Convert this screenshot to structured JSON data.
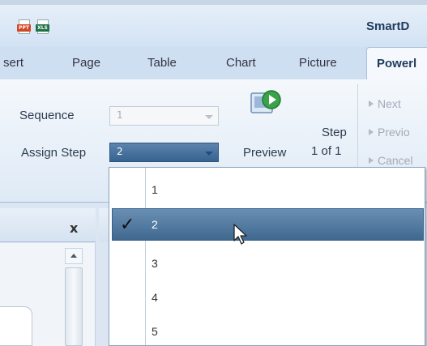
{
  "app": {
    "title": "SmartD"
  },
  "quick_access": {
    "icons": [
      "ppt-file-icon",
      "xls-file-icon"
    ],
    "ppt_label": "PPT",
    "xls_label": "XLS"
  },
  "tabs": [
    {
      "label": "sert",
      "active": false
    },
    {
      "label": "Page",
      "active": false
    },
    {
      "label": "Table",
      "active": false
    },
    {
      "label": "Chart",
      "active": false
    },
    {
      "label": "Picture",
      "active": false
    },
    {
      "label": "Powerl",
      "active": true
    }
  ],
  "ribbon": {
    "sequence": {
      "label": "Sequence",
      "value": "1"
    },
    "assign_step": {
      "label": "Assign Step",
      "value": "2"
    },
    "preview_label": "Preview",
    "step": {
      "label": "Step",
      "count": "1 of 1"
    },
    "nav": {
      "next": "Next",
      "previous": "Previo",
      "cancel": "Cancel"
    }
  },
  "panel": {
    "close_glyph": "x"
  },
  "dropdown": {
    "options": [
      "1",
      "2",
      "3",
      "4",
      "5"
    ],
    "selected": "2",
    "check_glyph": "✓"
  },
  "colors": {
    "accent_selection": "#40698f",
    "ribbon_bg": "#f4f8fc",
    "active_tab_text": "#1e3b5c"
  }
}
